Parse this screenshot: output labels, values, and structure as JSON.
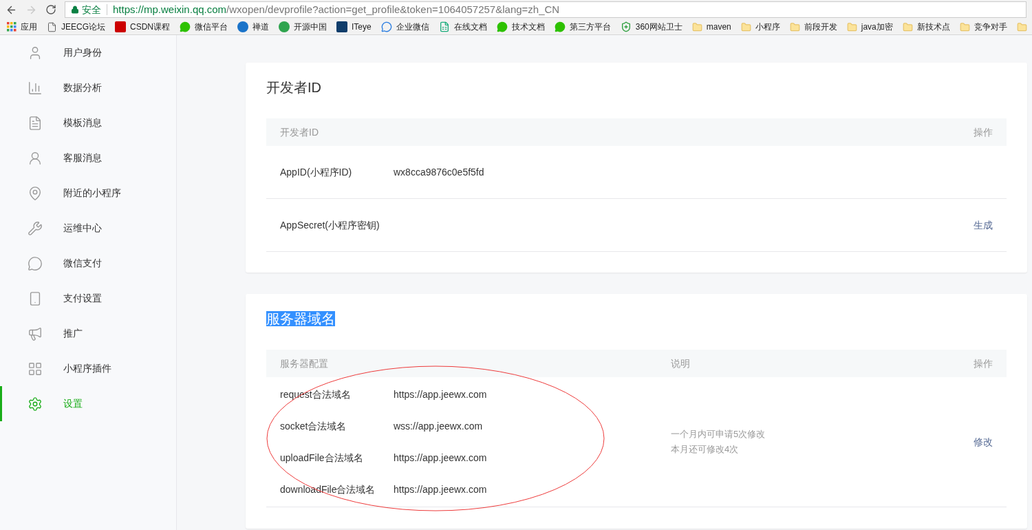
{
  "browser": {
    "forward_disabled": true,
    "secure_label": "安全",
    "url_host": "https://mp.weixin.qq.com",
    "url_path": "/wxopen/devprofile?action=get_profile&token=1064057257&lang=zh_CN"
  },
  "bookmarks": [
    {
      "kind": "apps",
      "label": "应用"
    },
    {
      "kind": "page",
      "label": "JEECG论坛"
    },
    {
      "kind": "csdn",
      "label": "CSDN课程"
    },
    {
      "kind": "chat",
      "label": "微信平台"
    },
    {
      "kind": "zt",
      "label": "禅道"
    },
    {
      "kind": "oschina",
      "label": "开源中国"
    },
    {
      "kind": "iteye",
      "label": "ITeye"
    },
    {
      "kind": "wework",
      "label": "企业微信"
    },
    {
      "kind": "doc",
      "label": "在线文档"
    },
    {
      "kind": "chat",
      "label": "技术文档"
    },
    {
      "kind": "chat",
      "label": "第三方平台"
    },
    {
      "kind": "shield",
      "label": "360网站卫士"
    },
    {
      "kind": "folder",
      "label": "maven"
    },
    {
      "kind": "folder",
      "label": "小程序"
    },
    {
      "kind": "folder",
      "label": "前段开发"
    },
    {
      "kind": "folder",
      "label": "java加密"
    },
    {
      "kind": "folder",
      "label": "新技术点"
    },
    {
      "kind": "folder",
      "label": "竞争对手"
    },
    {
      "kind": "folder"
    }
  ],
  "sidebar": {
    "items": [
      {
        "label": "用户身份",
        "selected": false
      },
      {
        "label": "数据分析",
        "selected": false
      },
      {
        "label": "模板消息",
        "selected": false
      },
      {
        "label": "客服消息",
        "selected": false
      },
      {
        "label": "附近的小程序",
        "selected": false
      },
      {
        "label": "运维中心",
        "selected": false
      },
      {
        "label": "微信支付",
        "selected": false
      },
      {
        "label": "支付设置",
        "selected": false
      },
      {
        "label": "推广",
        "selected": false
      },
      {
        "label": "小程序插件",
        "selected": false
      },
      {
        "label": "设置",
        "selected": true
      }
    ]
  },
  "developer_id": {
    "title": "开发者ID",
    "columns": [
      "开发者ID",
      "操作"
    ],
    "rows": [
      {
        "label": "AppID(小程序ID)",
        "value": "wx8cca9876c0e5f5fd"
      },
      {
        "label": "AppSecret(小程序密钥)",
        "action": "生成"
      }
    ]
  },
  "server_domains": {
    "title": "服务器域名",
    "title_highlighted": true,
    "columns": [
      "服务器配置",
      "说明",
      "操作"
    ],
    "rows": [
      {
        "label": "request合法域名",
        "value": "https://app.jeewx.com"
      },
      {
        "label": "socket合法域名",
        "value": "wss://app.jeewx.com"
      },
      {
        "label": "uploadFile合法域名",
        "value": "https://app.jeewx.com"
      },
      {
        "label": "downloadFile合法域名",
        "value": "https://app.jeewx.com"
      }
    ],
    "notes": [
      "一个月内可申请5次修改",
      "本月还可修改4次"
    ],
    "action": "修改"
  }
}
